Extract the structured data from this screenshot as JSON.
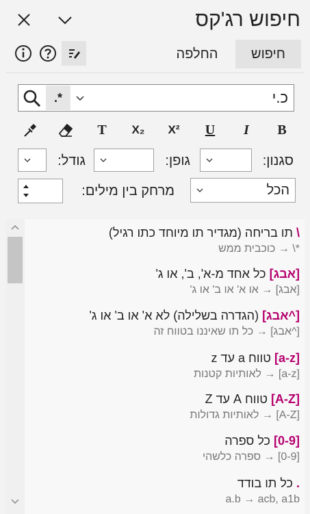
{
  "header": {
    "title": "חיפוש רג'קס"
  },
  "tabs": [
    {
      "label": "חיפוש",
      "active": true
    },
    {
      "label": "החלפה",
      "active": false
    }
  ],
  "search": {
    "value": "כ.י",
    "regex_symbol": ".*"
  },
  "format_buttons": [
    "B",
    "I",
    "U",
    "X²",
    "X₂",
    "T"
  ],
  "options": {
    "style_label": "סגנון:",
    "font_label": "גופן:",
    "size_label": "גודל:",
    "word_spacing_label": "מרחק בין מילים:",
    "scope_value": "הכל"
  },
  "help_items": [
    {
      "token": "\\",
      "desc": " תו בריחה (מגדיר תו מיוחד כתו רגיל)",
      "example": "‎\\*‎ → כוכבית ממש"
    },
    {
      "token": "[אבג]",
      "desc": " כל אחד מ-א', ב', או ג'",
      "example": "[אבג] → או א' או ב' או ג'"
    },
    {
      "token": "[^אבג]",
      "desc": " (הגדרה בשלילה) לא א' או ב' או ג'",
      "example": "[^אבג] → כל תו שאיננו בטווח זה"
    },
    {
      "token": "[a-z]",
      "desc": " טווח a עד z",
      "example": "[a-z] → לאותיות קטנות"
    },
    {
      "token": "[A-Z]",
      "desc": " טווח A עד Z",
      "example": "[A-Z] → לאותיות גדולות"
    },
    {
      "token": "[0-9]",
      "desc": " כל ספרה",
      "example": "[0-9] → ספרה כלשהי"
    },
    {
      "token": ".",
      "desc": " כל תו בודד",
      "example": "‎a.b → acb, a1b‎"
    }
  ],
  "colors": {
    "accent": "#b5006e",
    "background": "#f3f3f3"
  }
}
